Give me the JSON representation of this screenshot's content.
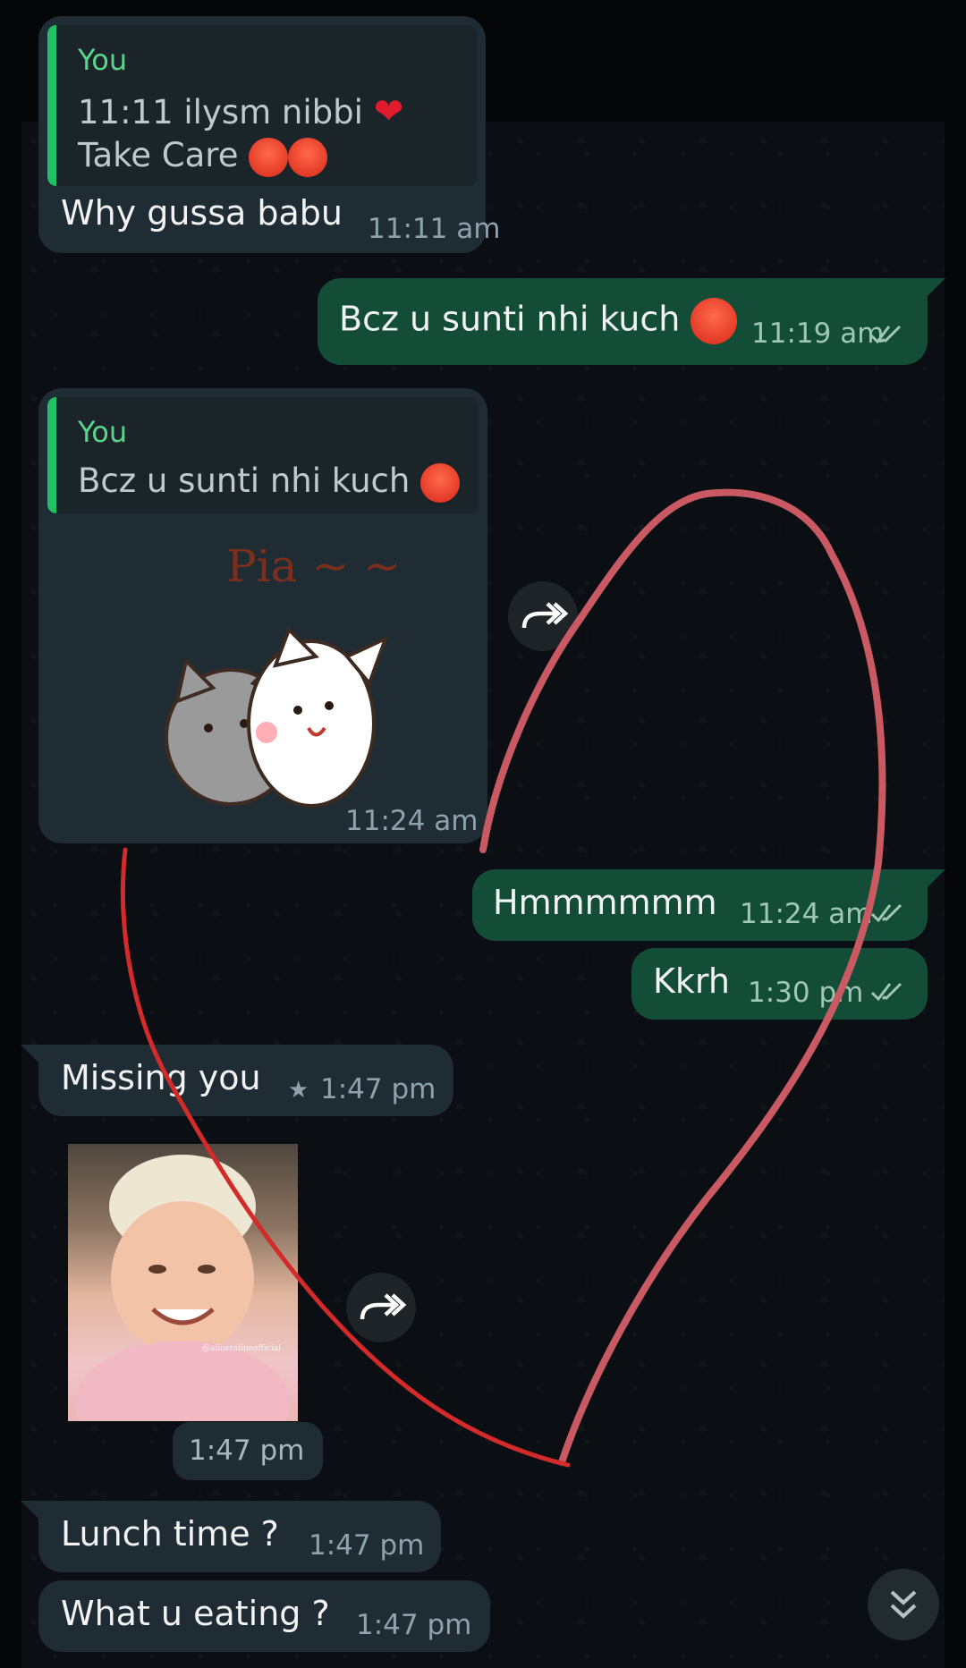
{
  "messages": [
    {
      "quote_author": "You",
      "quote_line1": "11:11 ilysm nibbi",
      "quote_line2": "Take Care",
      "text": "Why gussa babu",
      "time": "11:11 am"
    },
    {
      "text": "Bcz u sunti nhi kuch",
      "time": "11:19 am"
    },
    {
      "quote_author": "You",
      "quote_line1": "Bcz u sunti nhi kuch",
      "sticker_text": "Pia ~ ~",
      "time": "11:24 am"
    },
    {
      "text": "Hmmmmmm",
      "time": "11:24 am"
    },
    {
      "text": "Kkrh",
      "time": "1:30 pm"
    },
    {
      "text": "Missing you",
      "time": "1:47 pm",
      "starred": true
    },
    {
      "photo_watermark": "@alinetalineofficial",
      "time": "1:47 pm"
    },
    {
      "text": "Lunch time ?",
      "time": "1:47 pm"
    },
    {
      "text": "What u eating ?",
      "time": "1:47 pm"
    }
  ],
  "colors": {
    "incoming_bubble": "#202c33",
    "outgoing_bubble": "#144d37",
    "quote_bar": "#21c063",
    "quote_name": "#5cd38a",
    "annotation_stroke": "#c95a63"
  },
  "icons": {
    "forward": "forward-arrow-icon",
    "read_receipt": "double-check-icon",
    "star": "star-icon",
    "scroll_down": "double-chevron-down-icon"
  }
}
